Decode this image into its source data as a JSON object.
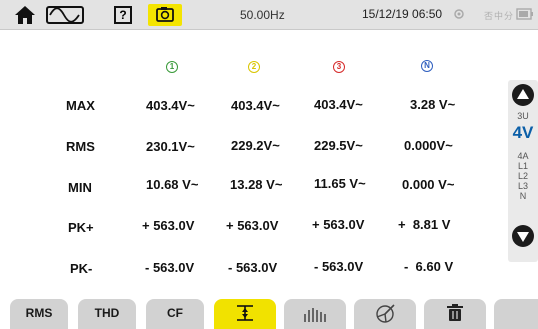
{
  "status_bar": {
    "frequency": "50.00Hz",
    "datetime": "15/12/19 06:50",
    "status_text": "否中分"
  },
  "colors": {
    "phase1": "#3a9a3a",
    "phase2": "#d9c500",
    "phase3": "#d62b2b",
    "neutral": "#2f5fbf",
    "active_tab": "#f1e200",
    "selected_option": "#0b5fa8"
  },
  "columns": [
    {
      "label": "1",
      "color": "phase1"
    },
    {
      "label": "2",
      "color": "phase2"
    },
    {
      "label": "3",
      "color": "phase3"
    },
    {
      "label": "N",
      "color": "neutral"
    }
  ],
  "rows": [
    {
      "label": "MAX",
      "values": [
        "403.4V~",
        "403.4V~",
        "403.4V~",
        "3.28 V~"
      ]
    },
    {
      "label": "RMS",
      "values": [
        "230.1V~",
        "229.2V~",
        "229.5V~",
        "0.000V~"
      ]
    },
    {
      "label": "MIN",
      "values": [
        "10.68 V~",
        "13.28 V~",
        "11.65 V~",
        "0.000 V~"
      ]
    },
    {
      "label": "PK+",
      "values": [
        "+ 563.0V",
        "+ 563.0V",
        "+ 563.0V",
        "+  8.81 V"
      ]
    },
    {
      "label": "PK-",
      "values": [
        "- 563.0V",
        "- 563.0V",
        "- 563.0V",
        "-  6.60 V"
      ]
    }
  ],
  "side_options": {
    "above": "3U",
    "selected": "4V",
    "below": [
      "4A",
      "L1",
      "L2",
      "L3",
      "N"
    ]
  },
  "tabs": [
    {
      "label": "RMS",
      "icon": null
    },
    {
      "label": "THD",
      "icon": null
    },
    {
      "label": "CF",
      "icon": null
    },
    {
      "label": "",
      "icon": "min-max-icon"
    },
    {
      "label": "",
      "icon": "bar-chart-icon"
    },
    {
      "label": "",
      "icon": "vector-icon"
    },
    {
      "label": "",
      "icon": "trash-icon"
    },
    {
      "label": "",
      "icon": null
    }
  ]
}
